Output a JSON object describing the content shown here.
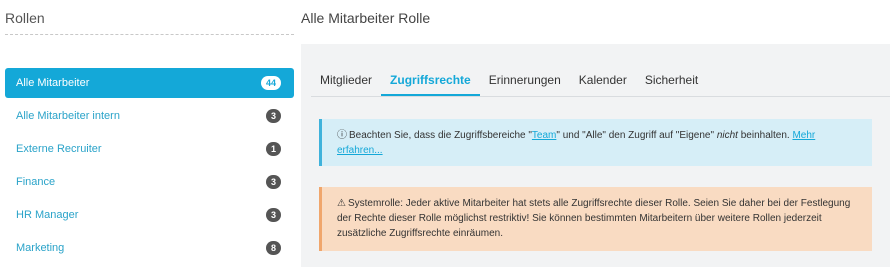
{
  "sidebar": {
    "title": "Rollen",
    "roles": [
      {
        "label": "Alle Mitarbeiter",
        "count": "44"
      },
      {
        "label": "Alle Mitarbeiter intern",
        "count": "3"
      },
      {
        "label": "Externe Recruiter",
        "count": "1"
      },
      {
        "label": "Finance",
        "count": "3"
      },
      {
        "label": "HR Manager",
        "count": "3"
      },
      {
        "label": "Marketing",
        "count": "8"
      }
    ]
  },
  "main": {
    "title": "Alle Mitarbeiter Rolle",
    "tabs": [
      {
        "label": "Mitglieder"
      },
      {
        "label": "Zugriffsrechte"
      },
      {
        "label": "Erinnerungen"
      },
      {
        "label": "Kalender"
      },
      {
        "label": "Sicherheit"
      }
    ],
    "info": {
      "icon": "info-circle-icon",
      "text_1": "Beachten Sie, dass die Zugriffsbereiche \"",
      "link_team": "Team",
      "text_2": "\" und \"Alle\" den Zugriff auf \"Eigene\" ",
      "emph": "nicht",
      "text_3": " beinhalten. ",
      "link_more": "Mehr erfahren..."
    },
    "warning": {
      "icon": "warning-triangle-icon",
      "text": "Systemrolle: Jeder aktive Mitarbeiter hat stets alle Zugriffsrechte dieser Rolle. Seien Sie daher bei der Festlegung der Rechte dieser Rolle möglichst restriktiv! Sie können bestimmten Mitarbeitern über weitere Rollen jederzeit zusätzliche Zugriffsrechte einräumen."
    }
  }
}
